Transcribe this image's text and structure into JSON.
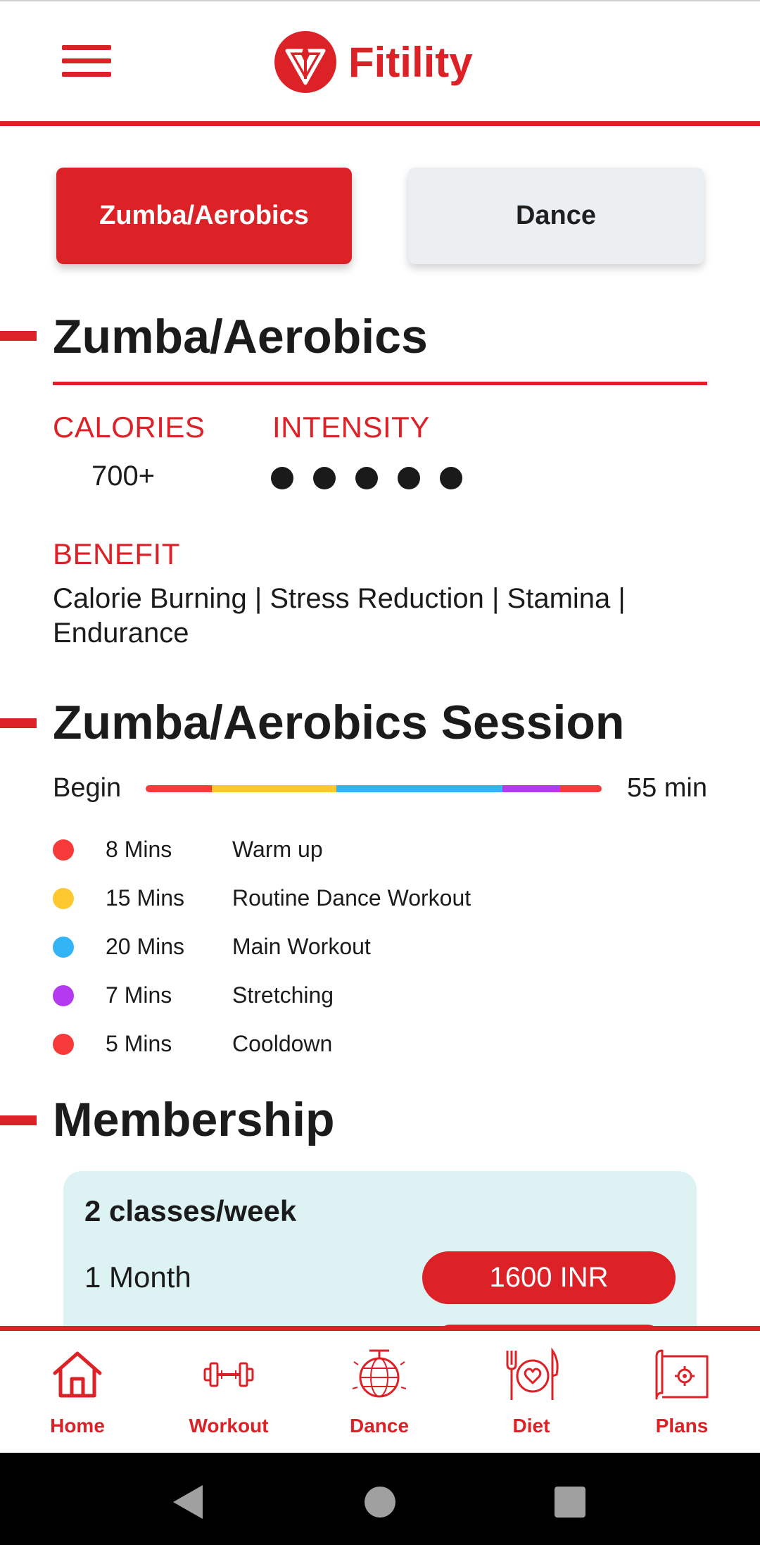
{
  "header": {
    "brand": "Fitility"
  },
  "categories": {
    "active": "Zumba/Aerobics",
    "inactive": "Dance"
  },
  "overview": {
    "title": "Zumba/Aerobics",
    "calories_label": "CALORIES",
    "calories_value": "700+",
    "intensity_label": "INTENSITY",
    "intensity_level": 5,
    "benefit_label": "BENEFIT",
    "benefit_text": "Calorie Burning | Stress Reduction | Stamina | Endurance"
  },
  "session": {
    "title": "Zumba/Aerobics Session",
    "begin_label": "Begin",
    "end_label": "55 min",
    "segments": [
      {
        "mins": "8 Mins",
        "name": "Warm up",
        "minutes": 8,
        "color": "#f63a3a"
      },
      {
        "mins": "15 Mins",
        "name": "Routine Dance Workout",
        "minutes": 15,
        "color": "#fcc82e"
      },
      {
        "mins": "20 Mins",
        "name": "Main Workout",
        "minutes": 20,
        "color": "#33b5f5"
      },
      {
        "mins": "7 Mins",
        "name": "Stretching",
        "minutes": 7,
        "color": "#b43af0"
      },
      {
        "mins": "5 Mins",
        "name": "Cooldown",
        "minutes": 5,
        "color": "#f63a3a"
      }
    ]
  },
  "membership": {
    "title": "Membership",
    "plan_title": "2 classes/week",
    "duration": "1 Month",
    "price": "1600 INR"
  },
  "bottom_nav": [
    {
      "label": "Home",
      "icon": "home-icon"
    },
    {
      "label": "Workout",
      "icon": "dumbbell-icon"
    },
    {
      "label": "Dance",
      "icon": "disco-ball-icon"
    },
    {
      "label": "Diet",
      "icon": "plate-heart-icon"
    },
    {
      "label": "Plans",
      "icon": "blueprint-gear-icon"
    }
  ],
  "colors": {
    "accent": "#dc2127",
    "card_bg": "#ddf3f3",
    "inactive_tab": "#eceff1"
  }
}
